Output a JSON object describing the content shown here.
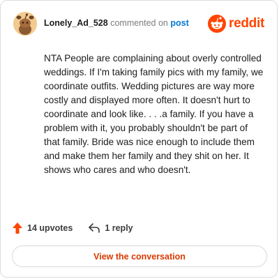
{
  "comment": {
    "author": "Lonely_Ad_528",
    "commented_on": "commented on",
    "post_link": "post",
    "body": "NTA People are complaining about overly controlled weddings. If I'm taking family pics with my family, we coordinate outfits. Wedding pictures are way more costly and displayed more often. It doesn't hurt to coordinate and look like. . . .a family. If you have a problem with it, you probably shouldn't be part of that family. Bride was nice enough to include them and make them her family and they shit on her. It shows who cares and who doesn't."
  },
  "brand": {
    "name": "reddit",
    "icon": "reddit-logo-icon",
    "color": "#ff4500"
  },
  "actions": {
    "upvotes": "14 upvotes",
    "upvote_icon": "upvote-arrow-icon",
    "upvote_color": "#ff4500",
    "replies": "1 reply",
    "reply_icon": "reply-arrow-icon"
  },
  "cta": {
    "label": "View the conversation",
    "color": "#d93a00"
  }
}
